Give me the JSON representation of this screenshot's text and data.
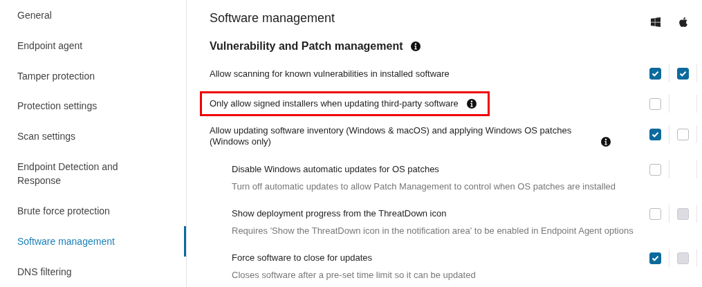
{
  "sidebar": {
    "items": [
      {
        "label": "General",
        "selected": false
      },
      {
        "label": "Endpoint agent",
        "selected": false
      },
      {
        "label": "Tamper protection",
        "selected": false
      },
      {
        "label": "Protection settings",
        "selected": false
      },
      {
        "label": "Scan settings",
        "selected": false
      },
      {
        "label": "Endpoint Detection and Response",
        "selected": false
      },
      {
        "label": "Brute force protection",
        "selected": false
      },
      {
        "label": "Software management",
        "selected": true
      },
      {
        "label": "DNS filtering",
        "selected": false
      }
    ]
  },
  "main": {
    "title": "Software management",
    "section": {
      "title": "Vulnerability and Patch management",
      "info": true
    },
    "settings": [
      {
        "label": "Allow scanning for known vulnerabilities in installed software",
        "info": false,
        "highlighted": false,
        "nested": false,
        "windows": {
          "checked": true,
          "disabled": false
        },
        "mac": {
          "checked": true,
          "disabled": false
        }
      },
      {
        "label": "Only allow signed installers when updating third-party software",
        "info": true,
        "highlighted": true,
        "nested": false,
        "windows": {
          "checked": false,
          "disabled": false
        }
      },
      {
        "label": "Allow updating software inventory (Windows & macOS) and applying Windows OS patches (Windows only)",
        "info": true,
        "highlighted": false,
        "nested": false,
        "windows": {
          "checked": true,
          "disabled": false
        },
        "mac": {
          "checked": false,
          "disabled": false
        }
      },
      {
        "label": "Disable Windows automatic updates for OS patches",
        "description": "Turn off automatic updates to allow Patch Management to control when OS patches are installed",
        "info": false,
        "highlighted": false,
        "nested": true,
        "windows": {
          "checked": false,
          "disabled": false
        }
      },
      {
        "label": "Show deployment progress from the ThreatDown icon",
        "description": "Requires 'Show the ThreatDown icon in the notification area' to be enabled in Endpoint Agent options",
        "info": false,
        "highlighted": false,
        "nested": true,
        "windows": {
          "checked": false,
          "disabled": false
        },
        "mac": {
          "checked": false,
          "disabled": true
        }
      },
      {
        "label": "Force software to close for updates",
        "description": "Closes software after a pre-set time limit so it can be updated",
        "info": false,
        "highlighted": false,
        "nested": true,
        "windows": {
          "checked": true,
          "disabled": false
        },
        "mac": {
          "checked": false,
          "disabled": true
        }
      }
    ]
  }
}
